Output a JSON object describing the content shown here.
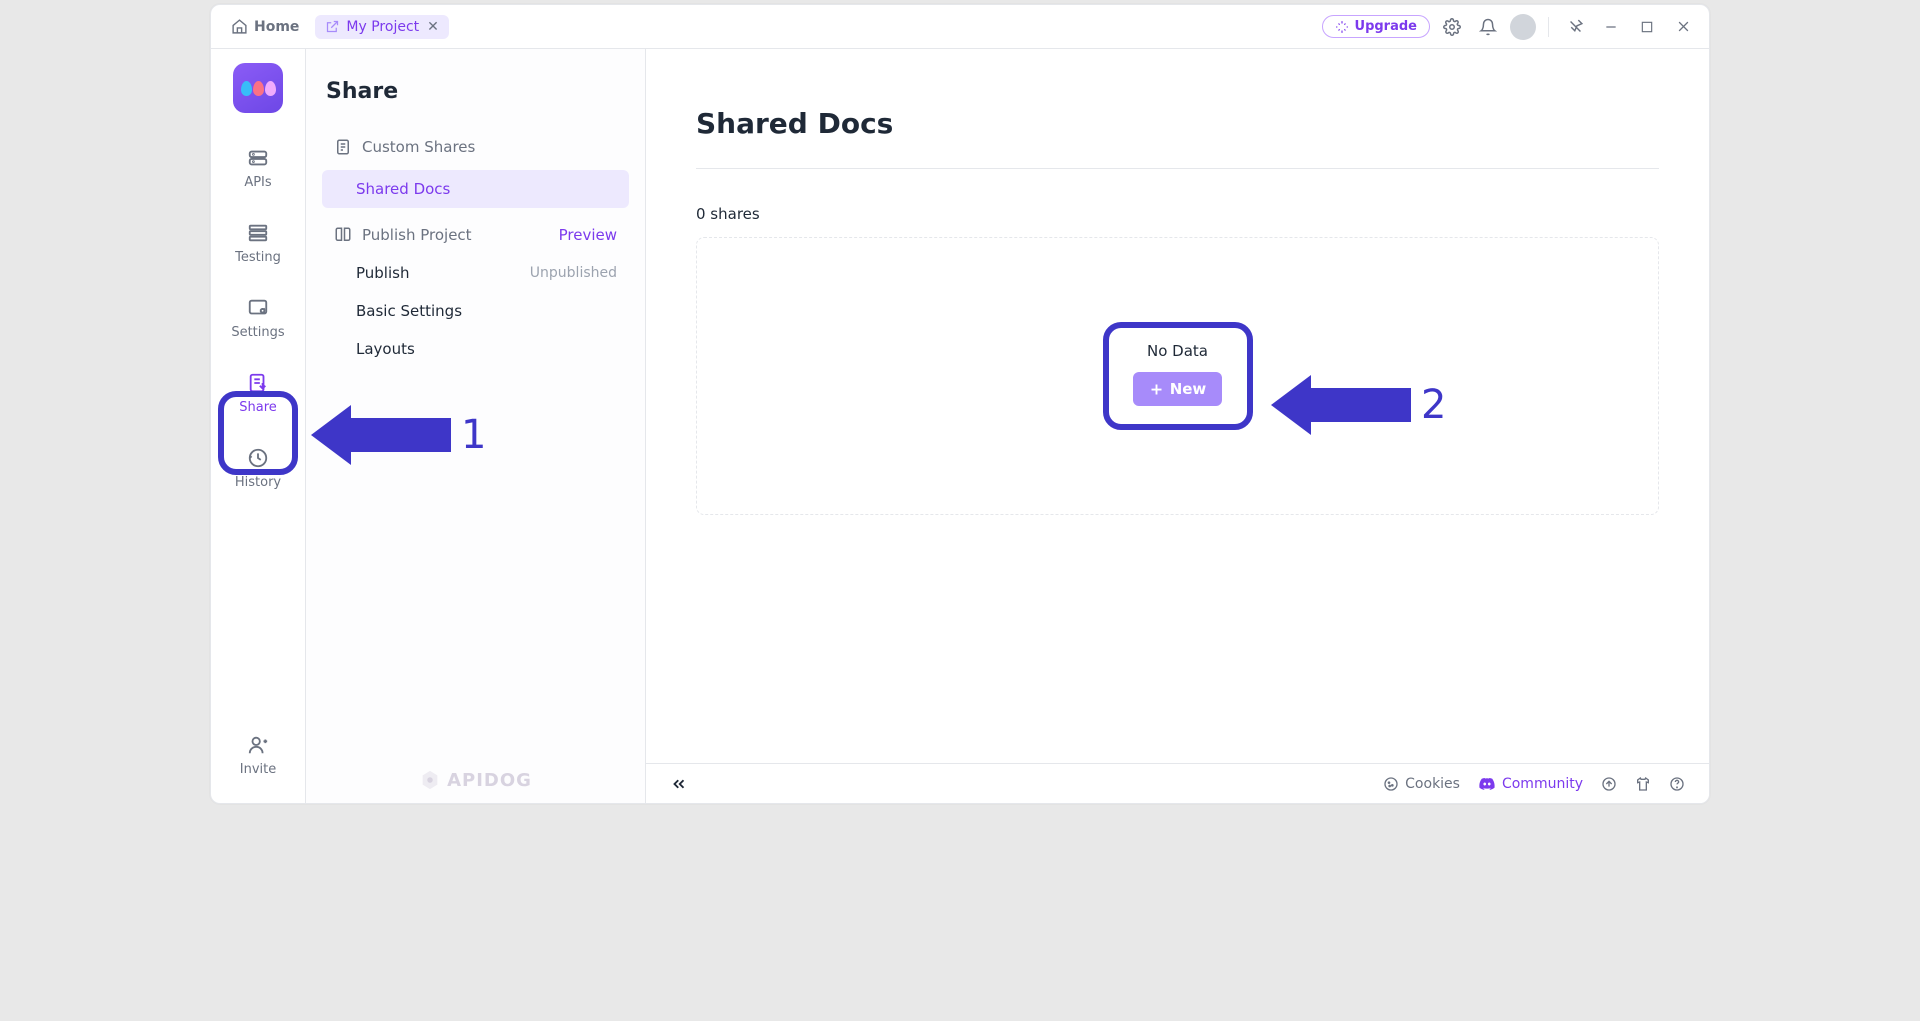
{
  "topbar": {
    "home_label": "Home",
    "tab_label": "My Project",
    "upgrade_label": "Upgrade"
  },
  "rail": {
    "apis": "APIs",
    "testing": "Testing",
    "settings": "Settings",
    "share": "Share",
    "history": "History",
    "invite": "Invite"
  },
  "sidebar": {
    "title": "Share",
    "custom_shares": "Custom Shares",
    "shared_docs": "Shared Docs",
    "publish_project": "Publish Project",
    "preview": "Preview",
    "publish": "Publish",
    "publish_status": "Unpublished",
    "basic_settings": "Basic Settings",
    "layouts": "Layouts",
    "brand": "APIDOG"
  },
  "main": {
    "title": "Shared Docs",
    "shares_count": "0 shares",
    "no_data": "No Data",
    "new_button": "New"
  },
  "bottombar": {
    "cookies": "Cookies",
    "community": "Community"
  },
  "annotations": {
    "one": "1",
    "two": "2"
  }
}
